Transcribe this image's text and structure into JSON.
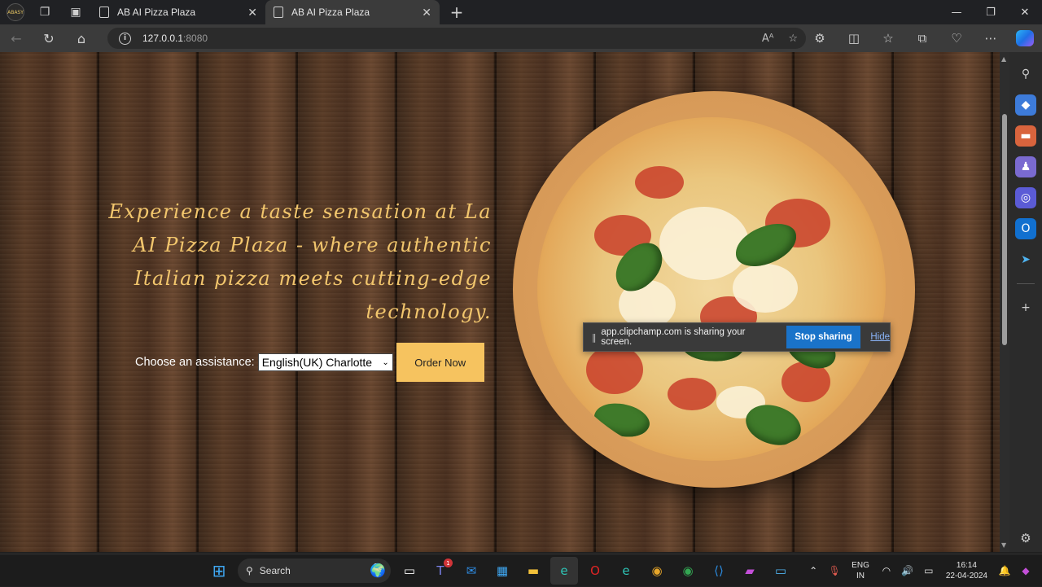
{
  "browser": {
    "profile_label": "ABASY",
    "tabs": [
      {
        "title": "AB AI Pizza Plaza",
        "active": false
      },
      {
        "title": "AB AI Pizza Plaza",
        "active": true
      }
    ],
    "url_host": "127.0.0.1",
    "url_port": ":8080"
  },
  "page": {
    "hero_text": "Experience a taste sensation at La AI Pizza Plaza - where authentic Italian pizza meets cutting-edge technology.",
    "assist_label": "Choose an assistance:",
    "assist_selected": "English(UK) Charlotte",
    "order_button": "Order Now"
  },
  "share_bar": {
    "message": "app.clipchamp.com is sharing your screen.",
    "stop_label": "Stop sharing",
    "hide_label": "Hide"
  },
  "taskbar": {
    "search_label": "Search",
    "lang_line1": "ENG",
    "lang_line2": "IN",
    "time": "16:14",
    "date": "22-04-2024",
    "teams_badge": "1"
  },
  "colors": {
    "hero_text": "#f2c66d",
    "order_button": "#f6c35f",
    "stop_sharing": "#1a73c9"
  }
}
